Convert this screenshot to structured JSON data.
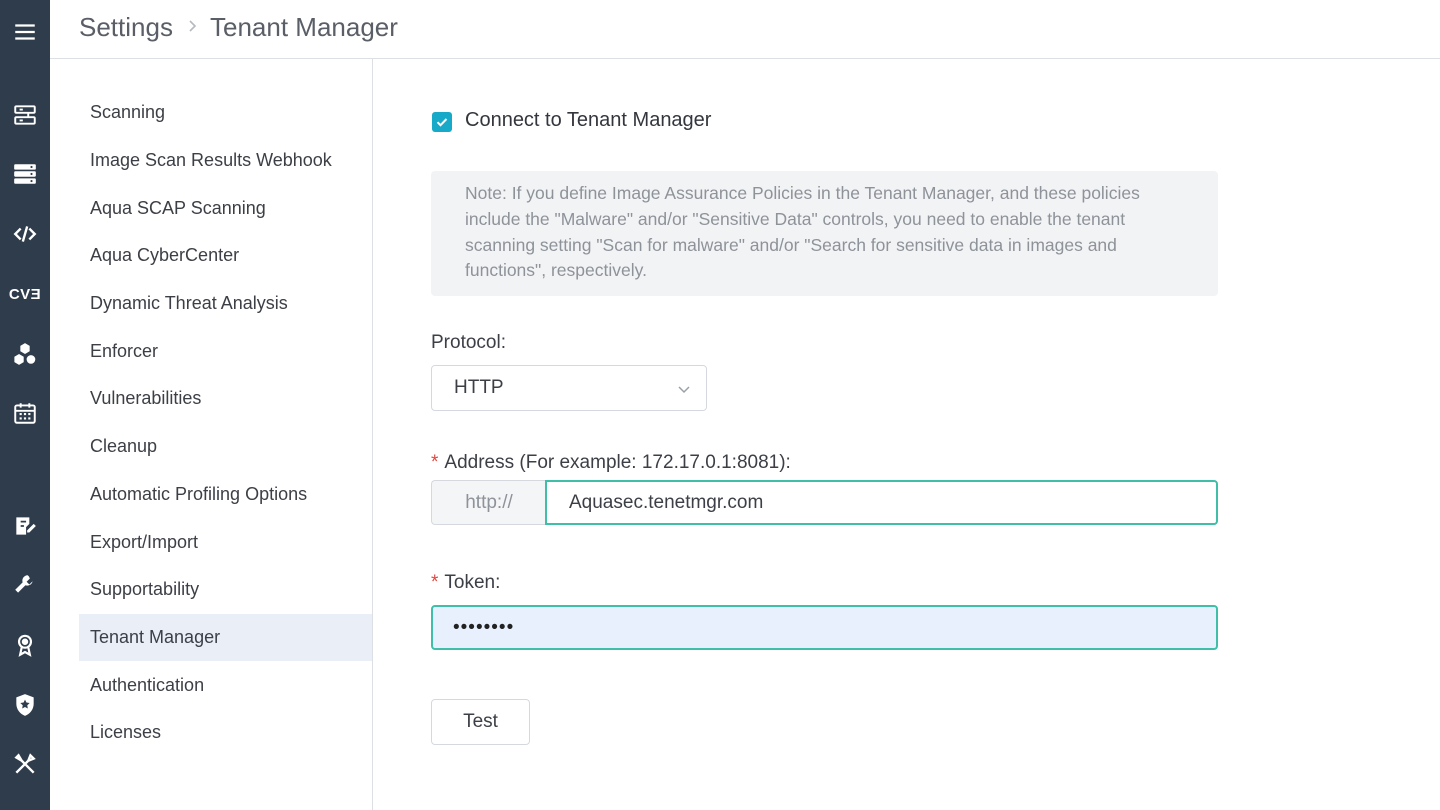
{
  "rail": {
    "icons": [
      "menu-icon",
      "network-icon",
      "server-icon",
      "code-icon",
      "cve-icon",
      "cluster-icon",
      "calendar-icon",
      "report-icon",
      "wrench-icon",
      "badge-icon",
      "shield-icon",
      "tools-icon"
    ],
    "cve_text": "CVƎ"
  },
  "header": {
    "breadcrumb_parent": "Settings",
    "breadcrumb_current": "Tenant Manager"
  },
  "menu": {
    "items": [
      {
        "label": "Scanning"
      },
      {
        "label": "Image Scan Results Webhook"
      },
      {
        "label": "Aqua SCAP Scanning"
      },
      {
        "label": "Aqua CyberCenter"
      },
      {
        "label": "Dynamic Threat Analysis"
      },
      {
        "label": "Enforcer"
      },
      {
        "label": "Vulnerabilities"
      },
      {
        "label": "Cleanup"
      },
      {
        "label": "Automatic Profiling Options"
      },
      {
        "label": "Export/Import"
      },
      {
        "label": "Supportability"
      },
      {
        "label": "Tenant Manager"
      },
      {
        "label": "Authentication"
      },
      {
        "label": "Licenses"
      }
    ],
    "active": "Tenant Manager"
  },
  "form": {
    "connect_label": "Connect to Tenant Manager",
    "connect_checked": true,
    "note": "Note: If you define Image Assurance Policies in the Tenant Manager, and these policies include the \"Malware\" and/or \"Sensitive Data\" controls, you need to enable the tenant scanning setting \"Scan for malware\" and/or \"Search for sensitive data in images and functions\", respectively.",
    "protocol_label": "Protocol:",
    "protocol_value": "HTTP",
    "address_required": "*",
    "address_label": "Address (For example: 172.17.0.1:8081):",
    "address_prefix": "http://",
    "address_value": "Aquasec.tenetmgr.com",
    "token_required": "*",
    "token_label": "Token:",
    "token_value": "••••••••",
    "test_label": "Test"
  },
  "colors": {
    "rail_bg": "#2f3c4b",
    "accent": "#17a9c8",
    "focus_border": "#3fbfa8",
    "required": "#e0463f",
    "active_menu_bg": "#e9eef7"
  }
}
